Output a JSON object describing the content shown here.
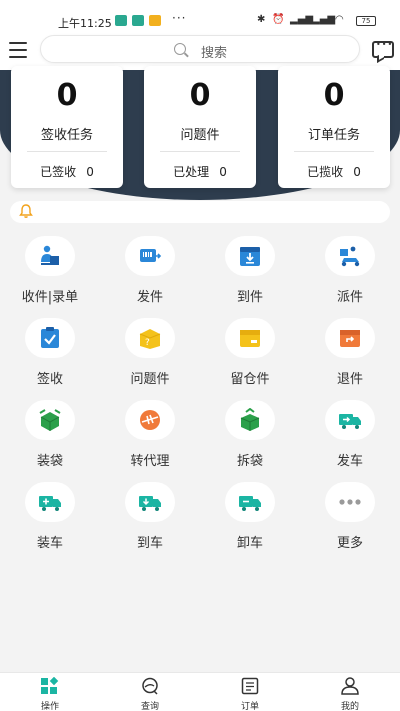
{
  "status_bar": {
    "time": "上午11:25",
    "dots": "···",
    "battery": "75"
  },
  "header": {
    "search_placeholder": "搜索"
  },
  "stats": [
    {
      "count": "0",
      "title": "签收任务",
      "sub_label": "已签收",
      "sub_value": "0"
    },
    {
      "count": "0",
      "title": "问题件",
      "sub_label": "已处理",
      "sub_value": "0"
    },
    {
      "count": "0",
      "title": "订单任务",
      "sub_label": "已揽收",
      "sub_value": "0"
    }
  ],
  "grid": [
    {
      "label": "收件|录单",
      "icon": "courier-icon"
    },
    {
      "label": "发件",
      "icon": "send-scanner-icon"
    },
    {
      "label": "到件",
      "icon": "arrive-box-icon"
    },
    {
      "label": "派件",
      "icon": "delivery-scooter-icon"
    },
    {
      "label": "签收",
      "icon": "sign-clipboard-icon"
    },
    {
      "label": "问题件",
      "icon": "problem-box-icon"
    },
    {
      "label": "留仓件",
      "icon": "hold-box-icon"
    },
    {
      "label": "退件",
      "icon": "return-box-icon"
    },
    {
      "label": "装袋",
      "icon": "pack-bag-icon"
    },
    {
      "label": "转代理",
      "icon": "transfer-agent-icon"
    },
    {
      "label": "拆袋",
      "icon": "unpack-bag-icon"
    },
    {
      "label": "发车",
      "icon": "truck-depart-icon"
    },
    {
      "label": "装车",
      "icon": "truck-load-icon"
    },
    {
      "label": "到车",
      "icon": "truck-arrive-icon"
    },
    {
      "label": "卸车",
      "icon": "truck-unload-icon"
    },
    {
      "label": "更多",
      "icon": "more-icon"
    }
  ],
  "tabs": [
    {
      "label": "操作",
      "icon": "operate-icon",
      "active": true
    },
    {
      "label": "查询",
      "icon": "query-icon",
      "active": false
    },
    {
      "label": "订单",
      "icon": "order-icon",
      "active": false
    },
    {
      "label": "我的",
      "icon": "profile-icon",
      "active": false
    }
  ],
  "colors": {
    "header_dark": "#2e3d4e",
    "teal": "#1bb5a3",
    "green": "#2ba04a",
    "blue": "#2a87d8",
    "yellow": "#f4c21b",
    "orange": "#f07a3a"
  }
}
